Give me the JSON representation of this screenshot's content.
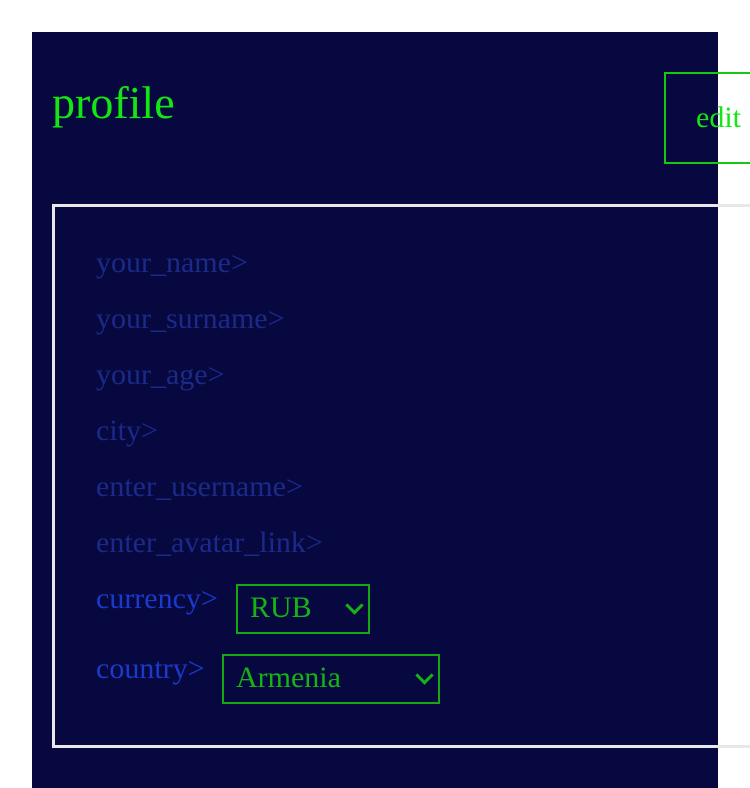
{
  "title": "profile",
  "edit_label": "edit",
  "fields": [
    {
      "label": "your_name>"
    },
    {
      "label": "your_surname>"
    },
    {
      "label": "your_age>"
    },
    {
      "label": "city>"
    },
    {
      "label": "enter_username>"
    },
    {
      "label": "enter_avatar_link>"
    }
  ],
  "currency": {
    "label": "currency>",
    "selected": "RUB"
  },
  "country": {
    "label": "country>",
    "selected": "Armenia"
  },
  "colors": {
    "background": "#080840",
    "accent": "#14e614",
    "label": "#1a2a88",
    "border": "#e8e8e8"
  },
  "icons": {
    "dropdown": "chevron-down-icon"
  }
}
